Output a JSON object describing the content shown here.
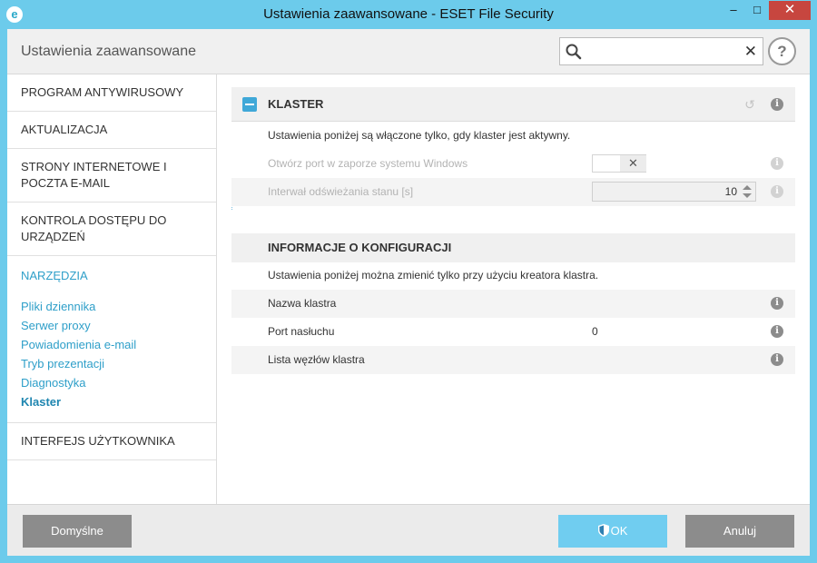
{
  "window": {
    "title": "Ustawienia zaawansowane - ESET File Security",
    "app_icon": "e",
    "minimize_glyph": "–",
    "maximize_glyph": "□",
    "close_glyph": "✕"
  },
  "header": {
    "title": "Ustawienia zaawansowane",
    "search_value": "",
    "search_placeholder": "",
    "clear_glyph": "✕",
    "help_glyph": "?"
  },
  "sidebar": {
    "sections": [
      {
        "label": "PROGRAM ANTYWIRUSOWY"
      },
      {
        "label": "AKTUALIZACJA"
      },
      {
        "label": "STRONY INTERNETOWE I POCZTA E-MAIL"
      },
      {
        "label": "KONTROLA DOSTĘPU DO URZĄDZEŃ"
      }
    ],
    "tools": {
      "heading": "NARZĘDZIA",
      "items": [
        {
          "label": "Pliki dziennika"
        },
        {
          "label": "Serwer proxy"
        },
        {
          "label": "Powiadomienia e-mail"
        },
        {
          "label": "Tryb prezentacji"
        },
        {
          "label": "Diagnostyka"
        },
        {
          "label": "Klaster",
          "active": true
        }
      ]
    },
    "last_section": {
      "label": "INTERFEJS UŻYTKOWNIKA"
    }
  },
  "cluster": {
    "title": "KLASTER",
    "description": "Ustawienia poniżej są włączone tylko, gdy klaster jest aktywny.",
    "open_port_label": "Otwórz port w zaporze systemu Windows",
    "open_port_state": "off",
    "toggle_glyph": "✕",
    "refresh_label": "Interwał odświeżania stanu [s]",
    "refresh_value": "10"
  },
  "config_info": {
    "title": "INFORMACJE O KONFIGURACJI",
    "description": "Ustawienia poniżej można zmienić tylko przy użyciu kreatora klastra.",
    "rows": [
      {
        "label": "Nazwa klastra",
        "value": ""
      },
      {
        "label": "Port nasłuchu",
        "value": "0"
      },
      {
        "label": "Lista węzłów klastra",
        "value": ""
      }
    ]
  },
  "info_glyph": "i",
  "undo_glyph": "↺",
  "footer": {
    "default_label": "Domyślne",
    "ok_label": "OK",
    "cancel_label": "Anuluj"
  },
  "colors": {
    "titlebar": "#6ccbeb",
    "accent": "#2e9fc9",
    "ok_button": "#70cdf0",
    "grey_button": "#8c8c8c",
    "close_button": "#c7463f"
  }
}
